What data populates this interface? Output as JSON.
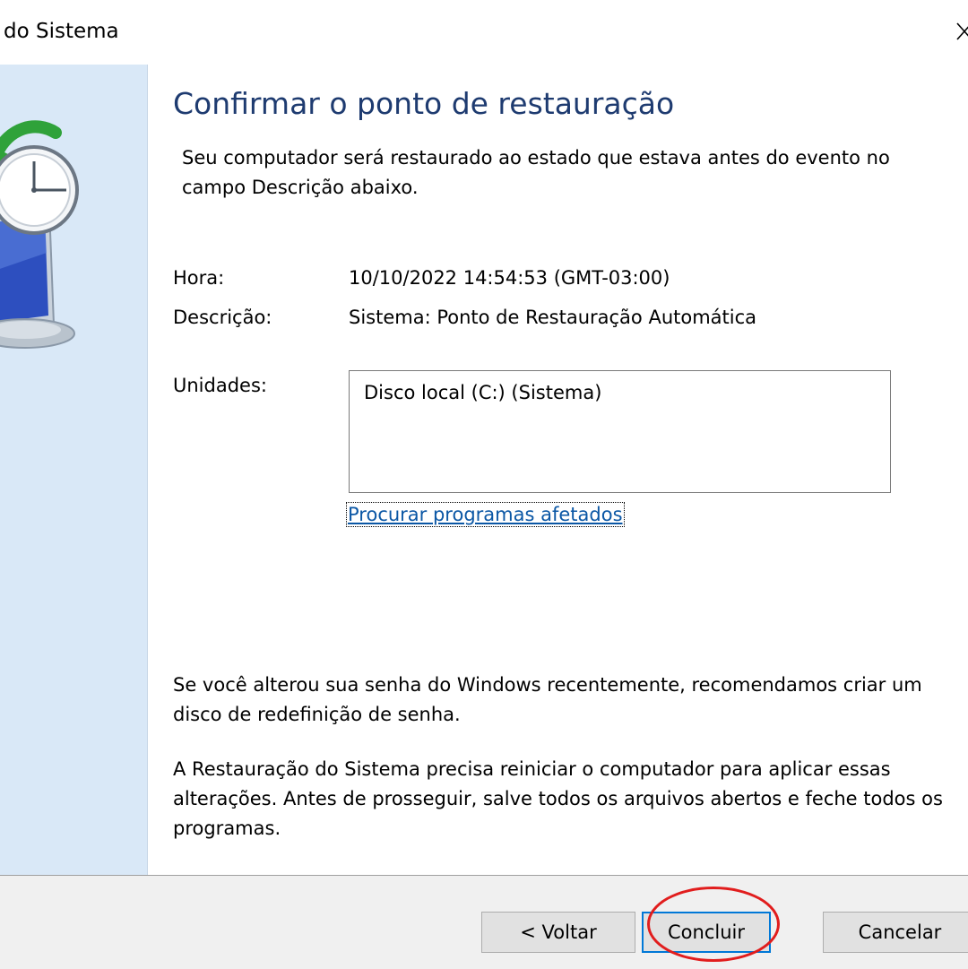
{
  "window": {
    "title": "do Sistema"
  },
  "main": {
    "heading": "Confirmar o ponto de restauração",
    "intro": "Seu computador será restaurado ao estado que estava antes do evento no campo Descrição abaixo.",
    "hora_label": "Hora:",
    "hora_value": "10/10/2022 14:54:53 (GMT-03:00)",
    "descricao_label": "Descrição:",
    "descricao_value": "Sistema: Ponto de Restauração Automática",
    "unidades_label": "Unidades:",
    "unidades_items": [
      "Disco local (C:) (Sistema)"
    ],
    "link": "Procurar programas afetados",
    "note1": "Se você alterou sua senha do Windows recentemente, recomendamos criar um disco de redefinição de senha.",
    "note2": "A Restauração do Sistema precisa reiniciar o computador para aplicar essas alterações. Antes de prosseguir, salve todos os arquivos abertos e feche todos os programas."
  },
  "footer": {
    "back_label": "< Voltar",
    "finish_label": "Concluir",
    "cancel_label": "Cancelar"
  },
  "icons": {
    "sidebar": "system-restore-clock-monitor-icon",
    "close": "close-icon"
  },
  "colors": {
    "sidebar_bg": "#d9e8f7",
    "heading": "#1e3b70",
    "link": "#0b57a5",
    "default_button_border": "#0078d7",
    "annotation": "#e11d1d"
  }
}
